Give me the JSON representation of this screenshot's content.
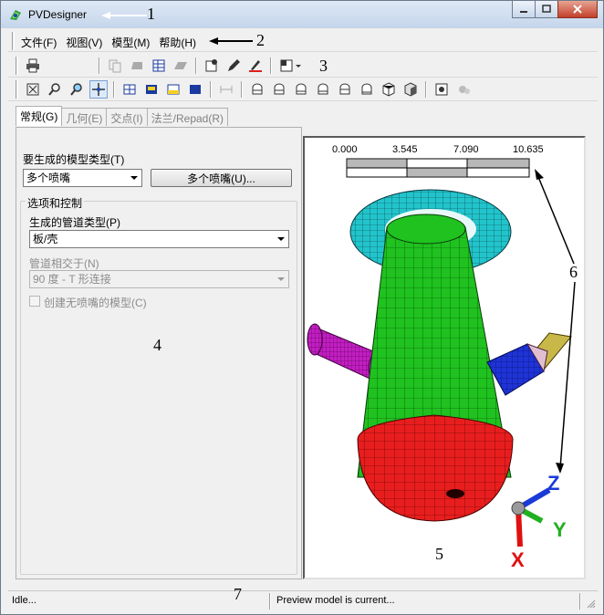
{
  "window": {
    "title": "PVDesigner"
  },
  "menu": [
    "文件(F)",
    "视图(V)",
    "模型(M)",
    "帮助(H)"
  ],
  "callouts": {
    "c1": "1",
    "c2": "2",
    "c3": "3",
    "c4": "4",
    "c5": "5",
    "c6": "6",
    "c7": "7"
  },
  "tabs": [
    "常规(G)",
    "几何(E)",
    "交点(I)",
    "法兰/Repad(R)"
  ],
  "general": {
    "model_type_label": "要生成的模型类型(T)",
    "model_type_value": "多个喷嘴",
    "model_type_button": "多个喷嘴(U)...",
    "options_group_label": "选项和控制",
    "pipe_type_label": "生成的管道类型(P)",
    "pipe_type_value": "板/壳",
    "intersect_label": "管道相交于(N)",
    "intersect_value": "90 度 - T 形连接",
    "no_nozzle_label": "创建无喷嘴的模型(C)"
  },
  "scale": {
    "ticks": [
      "0.000",
      "3.545",
      "7.090",
      "10.635"
    ]
  },
  "axes": {
    "x": "X",
    "y": "Y",
    "z": "Z"
  },
  "status": {
    "left": "Idle...",
    "right": "Preview model is current..."
  },
  "colors": {
    "shell": "#1fc21f",
    "bottom": "#e81e1e",
    "flange": "#22c4cc",
    "nozzle_left": "#c21ec2",
    "nozzle_right": "#1f33d6"
  }
}
